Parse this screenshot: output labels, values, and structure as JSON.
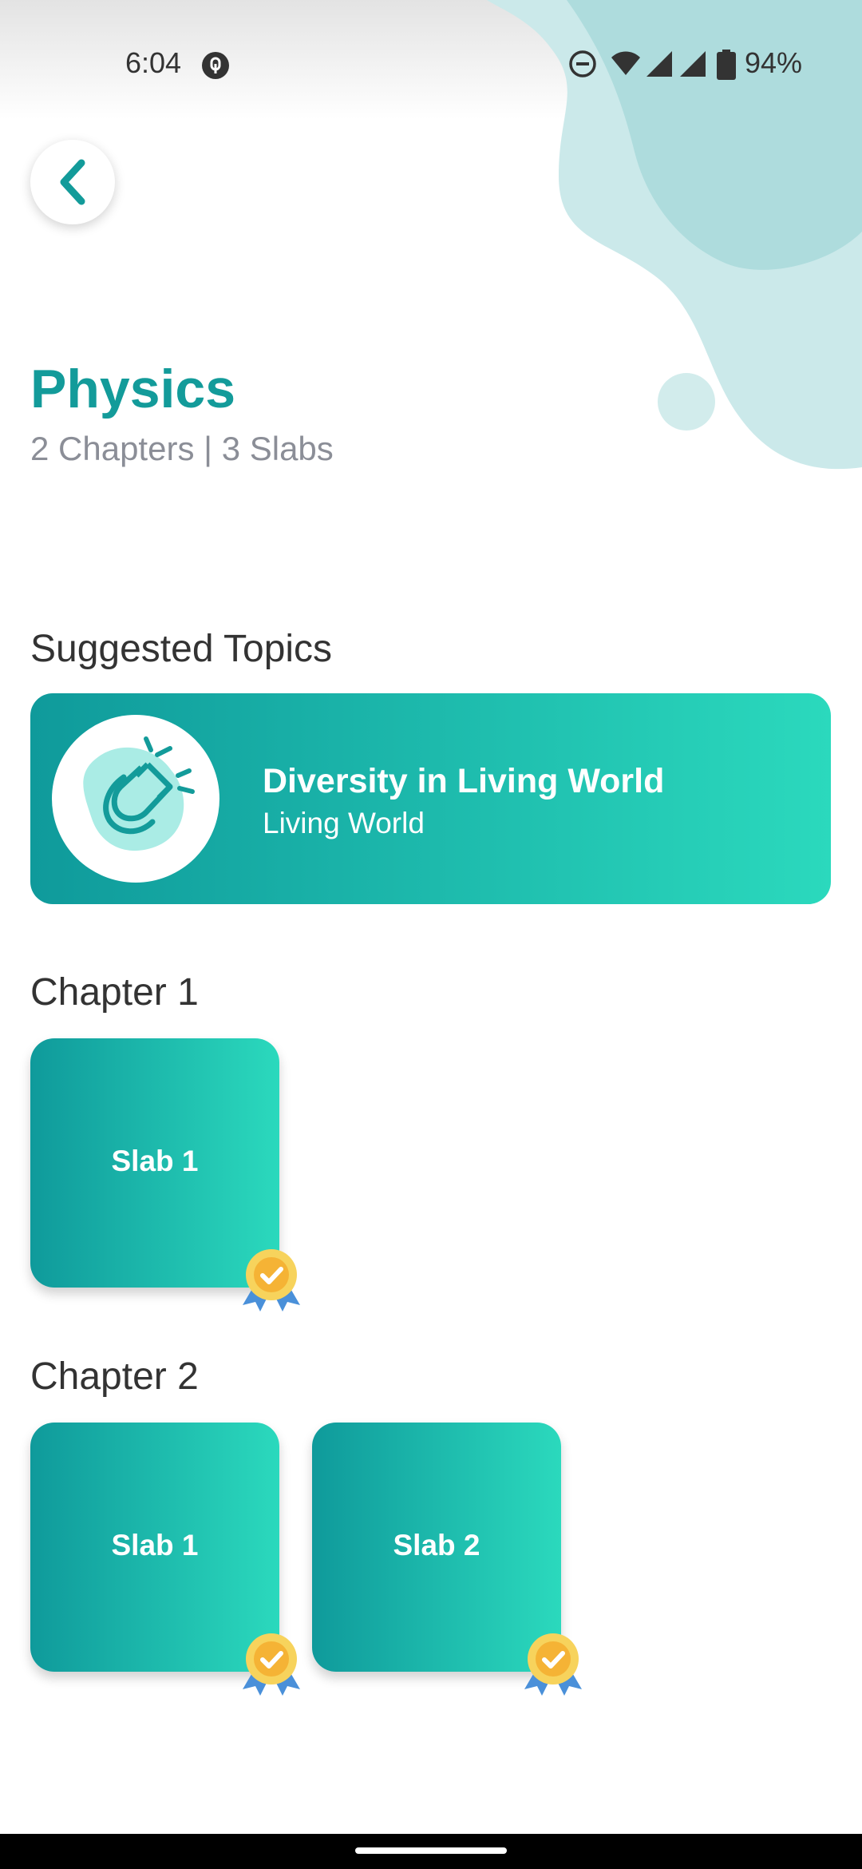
{
  "status_bar": {
    "time": "6:04",
    "battery": "94%",
    "icons": [
      "notification-icon",
      "do-not-disturb-icon",
      "wifi-icon",
      "signal-icon",
      "signal-icon",
      "battery-icon"
    ]
  },
  "header": {
    "back_icon": "chevron-left-icon",
    "title": "Physics",
    "subtitle": "2 Chapters | 3 Slabs"
  },
  "suggested": {
    "heading": "Suggested Topics",
    "topic": {
      "icon": "magnet-icon",
      "title": "Diversity in Living World",
      "subtitle": "Living World"
    }
  },
  "chapters": [
    {
      "heading": "Chapter 1",
      "slabs": [
        {
          "label": "Slab 1",
          "badge": "completed-badge-icon"
        }
      ]
    },
    {
      "heading": "Chapter 2",
      "slabs": [
        {
          "label": "Slab 1",
          "badge": "completed-badge-icon"
        },
        {
          "label": "Slab 2",
          "badge": "completed-badge-icon"
        }
      ]
    }
  ],
  "colors": {
    "accent": "#139b9a",
    "gradient_start": "#0f9a9b",
    "gradient_end": "#2bd9bd",
    "blob_light": "#cbe9ea",
    "blob_dark": "#aedcdd",
    "badge_gold": "#f5b335",
    "badge_ribbon": "#4a90d9"
  }
}
